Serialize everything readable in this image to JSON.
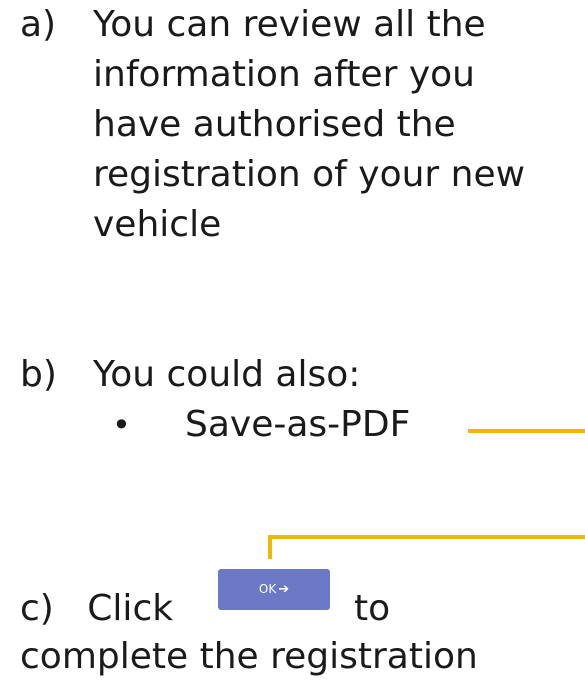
{
  "step_a": {
    "marker": "a)",
    "text": "You can review all the information after you have authorised the registration of your new vehicle"
  },
  "step_b": {
    "marker": "b)",
    "text": "You could also:",
    "bullets": [
      {
        "bullet": "•",
        "text": "Save-as-PDF"
      }
    ]
  },
  "step_c": {
    "marker": "c)",
    "click_text": "Click",
    "button_label": "OK",
    "button_icon": "arrow-right-icon",
    "button_arrow": "➔",
    "to_text": "to",
    "completion_text": "complete the registration"
  },
  "colors": {
    "accent_connector": "#f2b705",
    "button_bg": "#6a78c6",
    "text": "#1a1a1a"
  }
}
